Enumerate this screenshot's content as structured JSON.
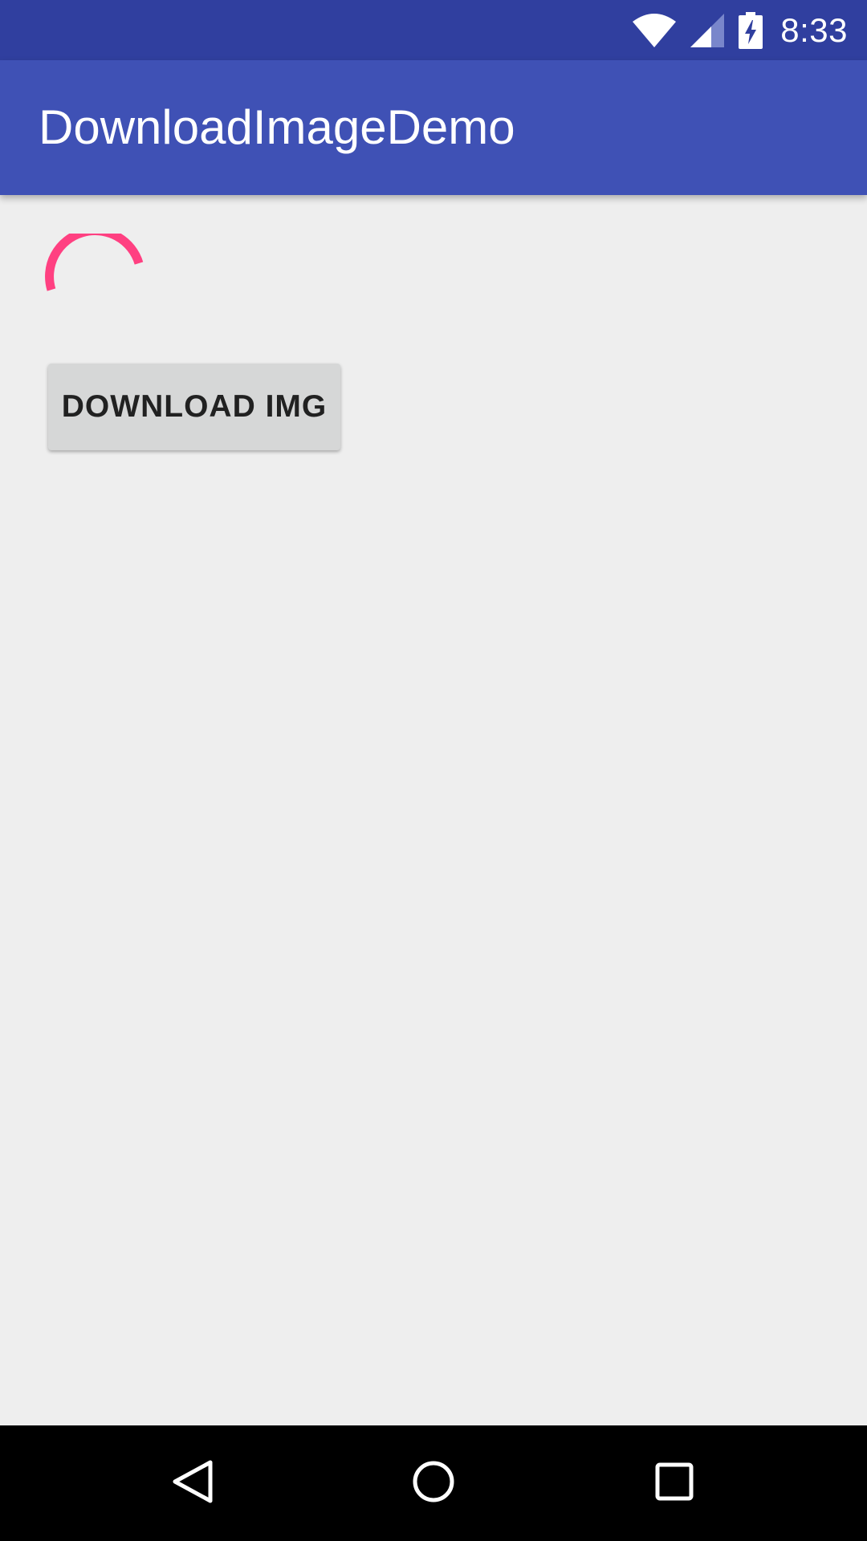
{
  "status_bar": {
    "time": "8:33",
    "icons": [
      "wifi-icon",
      "cell-signal-icon",
      "battery-charging-icon"
    ],
    "background": "#303f9f"
  },
  "app_bar": {
    "title": "DownloadImageDemo",
    "background": "#3f51b5"
  },
  "content": {
    "progress_indicator": {
      "type": "indeterminate-circular",
      "color": "#ff4081"
    },
    "download_button": {
      "label": "DOWNLOAD IMG"
    }
  },
  "nav_bar": {
    "buttons": [
      "back-icon",
      "home-icon",
      "recents-icon"
    ]
  }
}
